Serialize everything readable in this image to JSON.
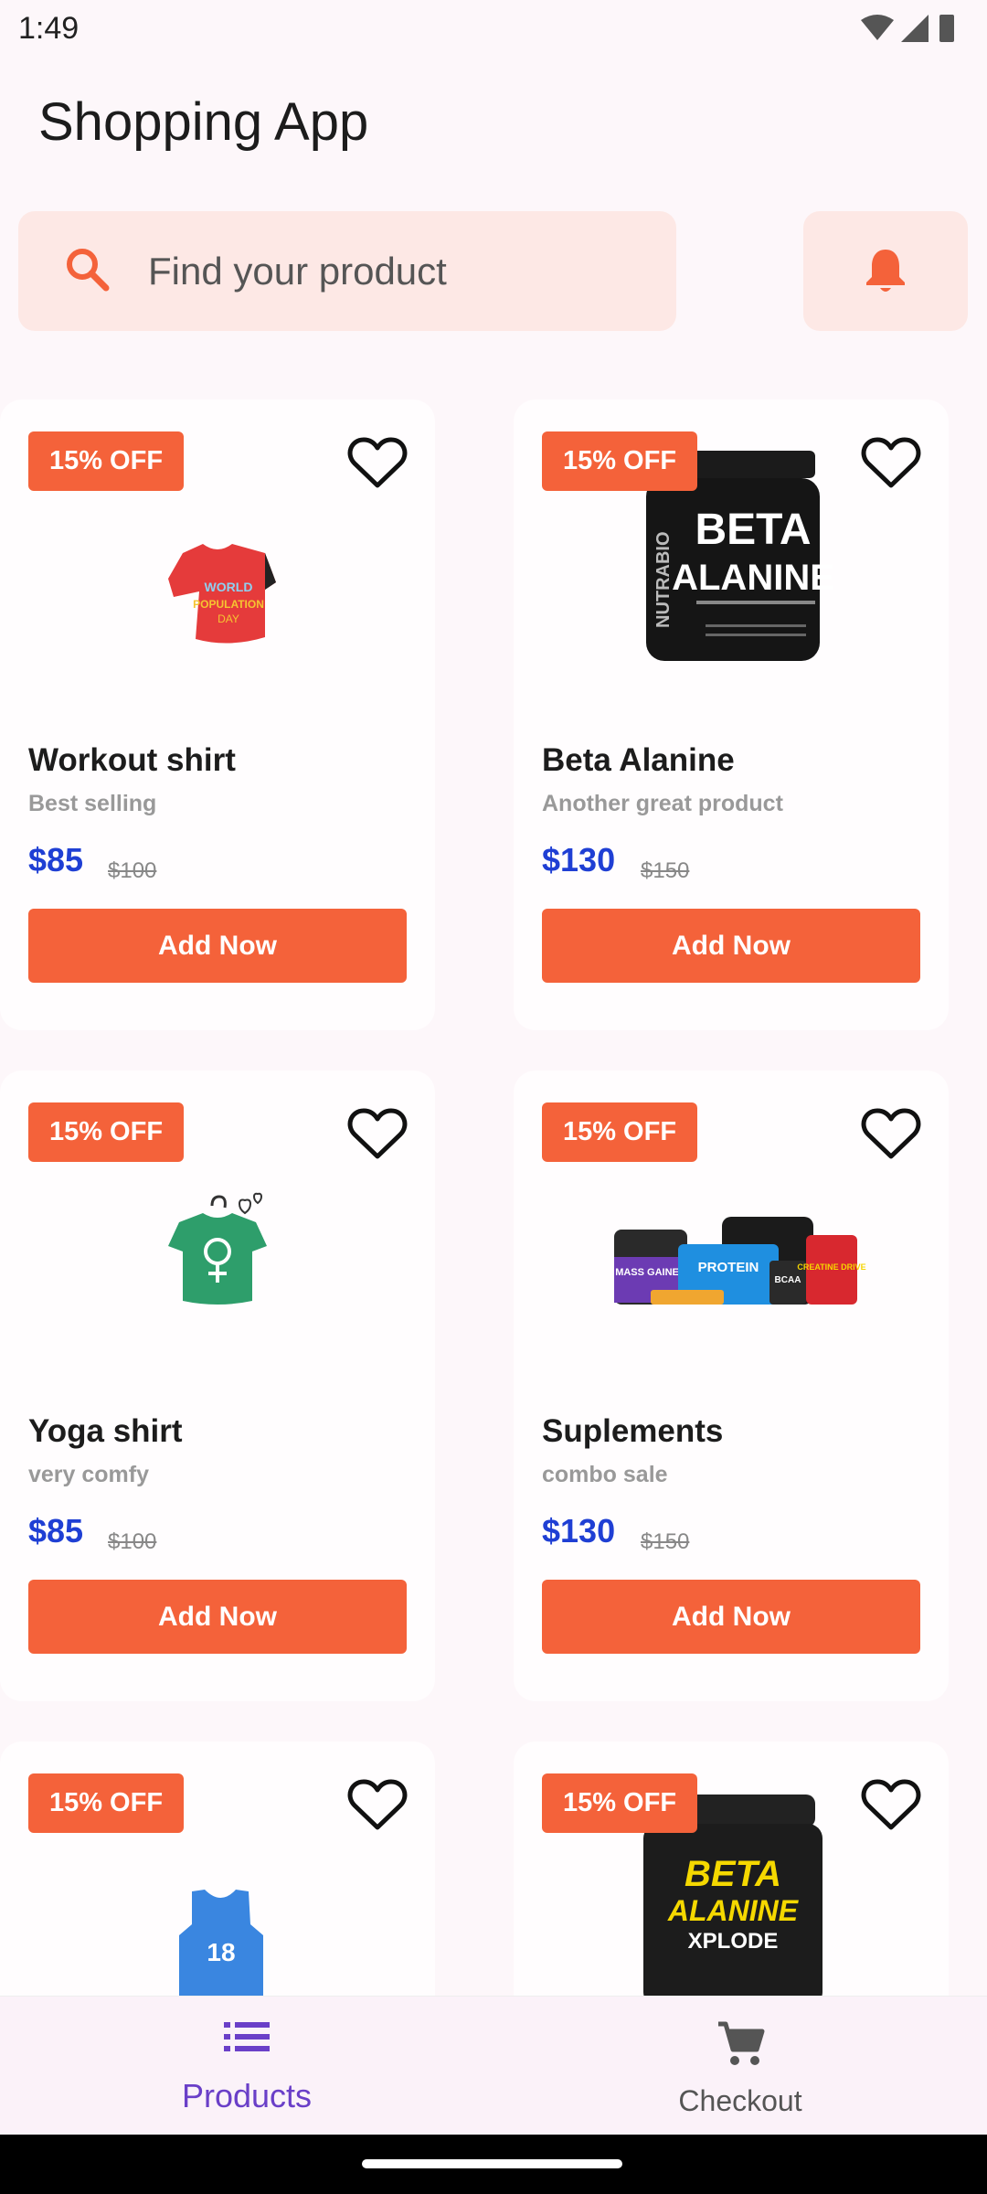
{
  "status_bar": {
    "time": "1:49"
  },
  "app": {
    "title": "Shopping App"
  },
  "search": {
    "placeholder": "Find your product"
  },
  "colors": {
    "accent": "#f4623a",
    "price": "#1f3fd4",
    "nav_active": "#6a3fc8"
  },
  "products": [
    {
      "badge": "15% OFF",
      "name": "Workout shirt",
      "subtitle": "Best selling",
      "price": "$85",
      "old_price": "$100",
      "button": "Add Now",
      "image": "red-tshirt-image"
    },
    {
      "badge": "15% OFF",
      "name": "Beta Alanine",
      "subtitle": "Another great product",
      "price": "$130",
      "old_price": "$150",
      "button": "Add Now",
      "image": "beta-alanine-jar-image",
      "image_text": [
        "NUTRABIO",
        "BETA",
        "ALANINE"
      ]
    },
    {
      "badge": "15% OFF",
      "name": "Yoga shirt",
      "subtitle": "very comfy",
      "price": "$85",
      "old_price": "$100",
      "button": "Add Now",
      "image": "green-tshirt-image"
    },
    {
      "badge": "15% OFF",
      "name": "Suplements",
      "subtitle": "combo sale",
      "price": "$130",
      "old_price": "$150",
      "button": "Add Now",
      "image": "supplements-combo-image",
      "image_text": [
        "MASS GAINER",
        "PROTEIN",
        "BCAA",
        "CREATINE DRIVE"
      ]
    },
    {
      "badge": "15% OFF",
      "image": "blue-jersey-image",
      "image_text": [
        "18"
      ]
    },
    {
      "badge": "15% OFF",
      "image": "beta-alanine-xplode-image",
      "image_text": [
        "BETA",
        "ALANINE",
        "XPLODE"
      ]
    }
  ],
  "bottom_nav": {
    "items": [
      {
        "label": "Products",
        "icon": "list-icon",
        "active": true
      },
      {
        "label": "Checkout",
        "icon": "cart-icon",
        "active": false
      }
    ]
  }
}
